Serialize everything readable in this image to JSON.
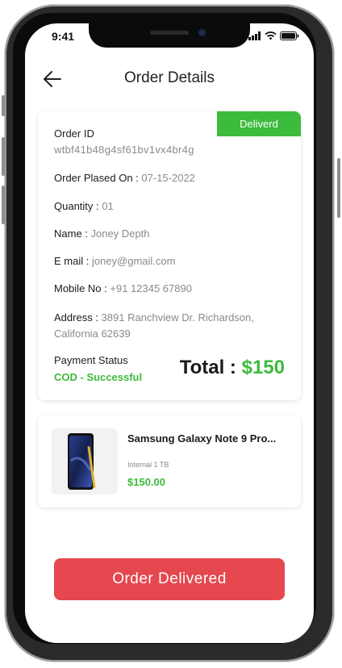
{
  "status_bar": {
    "time": "9:41"
  },
  "header": {
    "title": "Order Details",
    "back_icon": "arrow-left-icon"
  },
  "order": {
    "status_badge": "Deliverd",
    "order_id_label": "Order ID",
    "order_id_value": "wtbf41b48g4sf61bv1vx4br4g",
    "placed_label": "Order Plased On :",
    "placed_value": "07-15-2022",
    "quantity_label": "Quantity :",
    "quantity_value": "01",
    "name_label": "Name :",
    "name_value": "Joney Depth",
    "email_label": "E mail :",
    "email_value": "joney@gmail.com",
    "mobile_label": "Mobile No :",
    "mobile_value": "+91 12345 67890",
    "address_label": "Address :",
    "address_value": "3891 Ranchview Dr. Richardson, California 62639",
    "payment_label": "Payment Status",
    "payment_value": "COD - Successful",
    "total_label": "Total :",
    "total_value": "$150"
  },
  "product": {
    "name": "Samsung Galaxy Note 9 Pro...",
    "variant": "Internal 1 TB",
    "price": "$150.00"
  },
  "action": {
    "button_label": "Order Delivered"
  },
  "colors": {
    "accent_green": "#3dbb3d",
    "button_red": "#e5474e"
  }
}
